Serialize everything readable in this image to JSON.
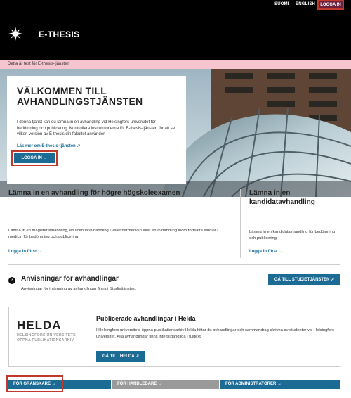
{
  "topbar": {
    "languages": [
      "SUOMI",
      "ENGLISH"
    ],
    "login": "LOGGA IN"
  },
  "header": {
    "brand": "E-THESIS",
    "logo_icon": "university-logo-icon"
  },
  "banner": {
    "text": "Detta är test för E-thesis-tjänsten"
  },
  "hero": {
    "title_line1": "VÄLKOMMEN TILL",
    "title_line2": "AVHANDLINGSTJÄNSTEN",
    "text": "I denna tjänst kan du lämna in en avhandling vid Helsingfors universitet för bedömning och publicering. Kontrollera instruktionerna för E-thesis-tjänsten för att se vilken version av E-thesis din fakultet använder.",
    "link": "Läs mer om E-thesis-tjänsten ↗",
    "button": "LOGGA IN →"
  },
  "submit": {
    "left_title": "Lämna in en avhandling för högre högskoleexamen",
    "left_text": "Lämna in en magisteravhandling, en licentiatavhandling i veterinärmedicin eller en avhandling inom fortsatta studier i medicin för bedömning och publicering.",
    "left_link": "Logga in först →",
    "right_title_line1": "Lämna in en",
    "right_title_line2": "kandidatavhandling",
    "right_text": "Lämna in en kandidatavhandling för bedömning och publicering.",
    "right_link": "Logga in först →"
  },
  "instructions": {
    "title": "Anvisningar för avhandlingar",
    "text": "Anvisningar för inlämning av avhandlingar finns i Studietjänsten.",
    "button": "GÅ TILL STUDIETJÄNSTEN ↗",
    "icon": "question-icon"
  },
  "helda": {
    "logo": "HELDA",
    "logo_sub_line1": "HELSINGFORS UNIVERSITETS",
    "logo_sub_line2": "ÖPPNA PUBLIKATIONSARKIV",
    "title": "Publicerade avhandlingar i Helda",
    "text": "I Helsingfors universitets öppna publikationsarkiv Helda hittar du avhandlingar och sammandrag skrivna av studenter vid Helsingfors universitet. Alla avhandlingar finns inte tillgängliga i fulltext.",
    "button": "GÅ TILL HELDA ↗"
  },
  "bottom_tabs": [
    {
      "label": "FÖR GRANSKARE →"
    },
    {
      "label": "FÖR HANDLEDARE →"
    },
    {
      "label": "FÖR ADMINISTRATÖRER →"
    }
  ],
  "colors": {
    "primary": "#1c6b95",
    "highlight": "#c0392b",
    "banner": "#f7c5cf",
    "header": "#000000"
  }
}
